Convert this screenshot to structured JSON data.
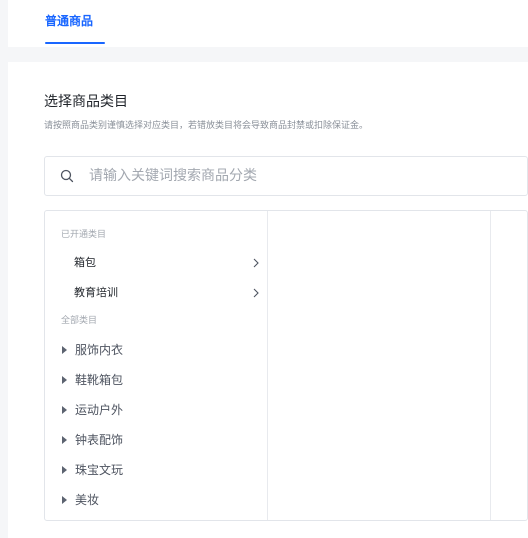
{
  "tabs": [
    {
      "label": "普通商品",
      "active": true
    }
  ],
  "section": {
    "title": "选择商品类目",
    "hint": "请按照商品类别谨慎选择对应类目，若错放类目将会导致商品封禁或扣除保证金。"
  },
  "search": {
    "icon": "search-icon",
    "placeholder": "请输入关键词搜索商品分类",
    "value": ""
  },
  "categories": {
    "opened_label": "已开通类目",
    "opened": [
      {
        "label": "箱包",
        "icon": "chevron-right-icon"
      },
      {
        "label": "教育培训",
        "icon": "chevron-right-icon"
      }
    ],
    "all_label": "全部类目",
    "all": [
      {
        "label": "服饰内衣",
        "icon": "caret-right-icon"
      },
      {
        "label": "鞋靴箱包",
        "icon": "caret-right-icon"
      },
      {
        "label": "运动户外",
        "icon": "caret-right-icon"
      },
      {
        "label": "钟表配饰",
        "icon": "caret-right-icon"
      },
      {
        "label": "珠宝文玩",
        "icon": "caret-right-icon"
      },
      {
        "label": "美妆",
        "icon": "caret-right-icon"
      }
    ]
  },
  "colors": {
    "accent": "#1966ff",
    "background": "#f5f6f8"
  }
}
